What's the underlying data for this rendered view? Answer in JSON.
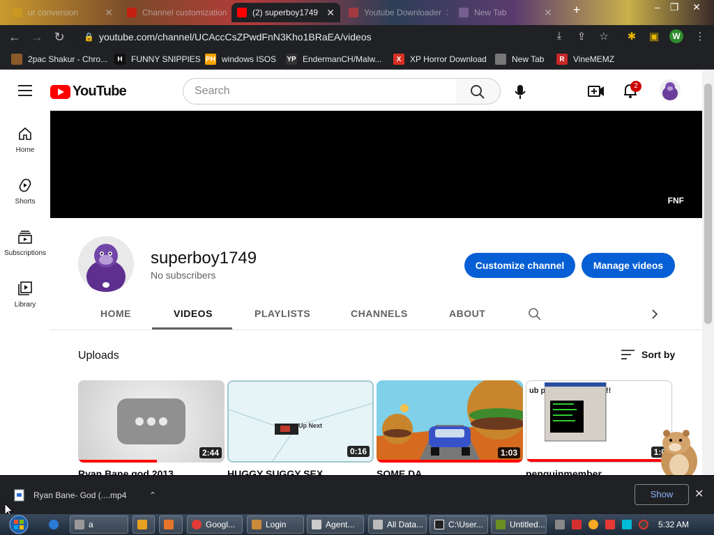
{
  "browser": {
    "tabs": [
      {
        "label": "ur conversion",
        "active": false
      },
      {
        "label": "Channel customization",
        "active": false
      },
      {
        "label": "(2) superboy1749",
        "active": true
      },
      {
        "label": "Youtube Downloader",
        "active": false
      },
      {
        "label": "New Tab",
        "active": false
      }
    ],
    "new_tab_symbol": "+",
    "url": "youtube.com/channel/UCAccCsZPwdFnN3Kho1BRaEA/videos",
    "profile_initial": "W",
    "bookmarks": [
      {
        "label": "2pac Shakur - Chro...",
        "icon_text": "",
        "icon_color": "#8a5a2b"
      },
      {
        "label": "FUNNY SNIPPIES",
        "icon_text": "H",
        "icon_color": "#111111"
      },
      {
        "label": "windows ISOS",
        "icon_text": "PH",
        "icon_color": "#f7a400"
      },
      {
        "label": "EndermanCH/Malw...",
        "icon_text": "YP",
        "icon_color": "#333333"
      },
      {
        "label": "XP Horror Download",
        "icon_text": "X",
        "icon_color": "#d93025"
      },
      {
        "label": "New Tab",
        "icon_text": "",
        "icon_color": "#777777"
      },
      {
        "label": "VineMEMZ",
        "icon_text": "R",
        "icon_color": "#c62828"
      }
    ]
  },
  "youtube": {
    "logo_text": "YouTube",
    "search_placeholder": "Search",
    "notification_count": "2",
    "sidebar": [
      {
        "label": "Home",
        "icon": "home-icon"
      },
      {
        "label": "Shorts",
        "icon": "shorts-icon"
      },
      {
        "label": "Subscriptions",
        "icon": "subscriptions-icon"
      },
      {
        "label": "Library",
        "icon": "library-icon"
      }
    ],
    "banner_label": "FNF",
    "channel": {
      "name": "superboy1749",
      "subscribers": "No subscribers",
      "customize_label": "Customize channel",
      "manage_label": "Manage videos"
    },
    "tabs": [
      "HOME",
      "VIDEOS",
      "PLAYLISTS",
      "CHANNELS",
      "ABOUT"
    ],
    "selected_tab": "VIDEOS",
    "uploads_title": "Uploads",
    "sort_label": "Sort by",
    "videos": [
      {
        "title": "Ryan Bane god 2013",
        "duration": "2:44",
        "progress": 0.54
      },
      {
        "title": "HUGGY SUGGY SEX",
        "duration": "0:16",
        "progress": 0,
        "thumb_text": "Up Next"
      },
      {
        "title": "SOME DA",
        "duration": "1:03",
        "progress": 1.0
      },
      {
        "title": "penguinmember",
        "duration": "1:0",
        "progress": 1.0,
        "thumb_text": "ub p ship generetor!!!!"
      }
    ]
  },
  "download_bar": {
    "filename": "Ryan Bane- God (....mp4",
    "show_all_label": "Show",
    "close_symbol": "✕"
  },
  "taskbar": {
    "buttons": [
      "a",
      "",
      "",
      "Googl...",
      "Login",
      "Agent...",
      "All Data...",
      "C:\\User...",
      "Untitled..."
    ],
    "clock": "5:32 AM"
  },
  "colors": {
    "accent_blue": "#065fd4",
    "youtube_red": "#ff0000",
    "chrome_dark": "#202124"
  }
}
